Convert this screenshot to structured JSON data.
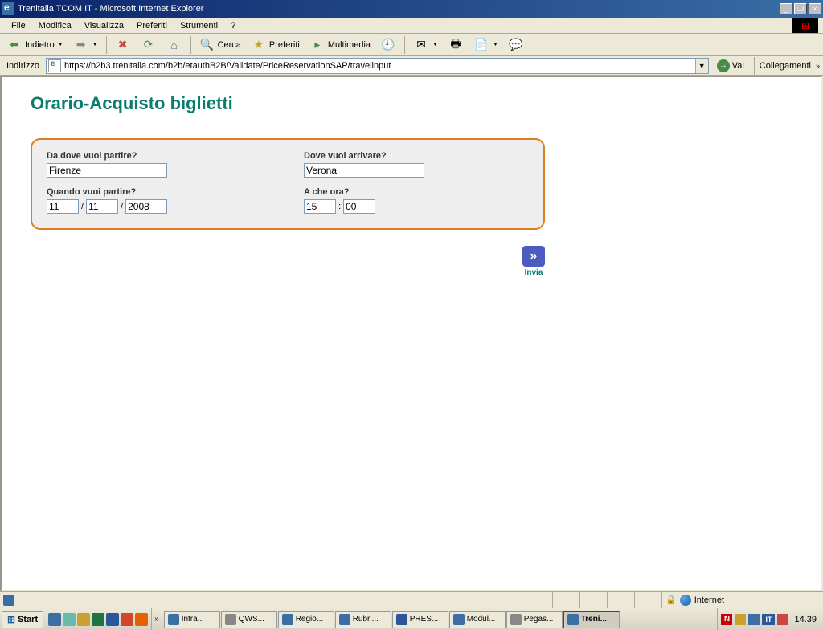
{
  "window": {
    "title": "Trenitalia TCOM IT - Microsoft Internet Explorer"
  },
  "menu": {
    "file": "File",
    "modifica": "Modifica",
    "visualizza": "Visualizza",
    "preferiti": "Preferiti",
    "strumenti": "Strumenti",
    "help": "?"
  },
  "toolbar": {
    "indietro": "Indietro",
    "cerca": "Cerca",
    "preferiti": "Preferiti",
    "multimedia": "Multimedia"
  },
  "addressbar": {
    "label": "Indirizzo",
    "url": "https://b2b3.trenitalia.com/b2b/etauthB2B/Validate/PriceReservationSAP/travelinput",
    "go": "Vai",
    "links": "Collegamenti"
  },
  "page": {
    "title": "Orario-Acquisto biglietti",
    "from_label": "Da dove vuoi partire?",
    "from_value": "Firenze",
    "to_label": "Dove vuoi arrivare?",
    "to_value": "Verona",
    "when_label": "Quando vuoi partire?",
    "date_day": "11",
    "date_month": "11",
    "date_year": "2008",
    "date_sep": "/",
    "time_label": "A che ora?",
    "time_hour": "15",
    "time_min": "00",
    "time_sep": ":",
    "submit": "Invia"
  },
  "statusbar": {
    "zone": "Internet"
  },
  "taskbar": {
    "start": "Start",
    "items": [
      "Intra...",
      "QWS...",
      "Regio...",
      "Rubri...",
      "PRES...",
      "Modul...",
      "Pegas...",
      "Treni..."
    ],
    "clock": "14.39",
    "lang": "IT"
  }
}
